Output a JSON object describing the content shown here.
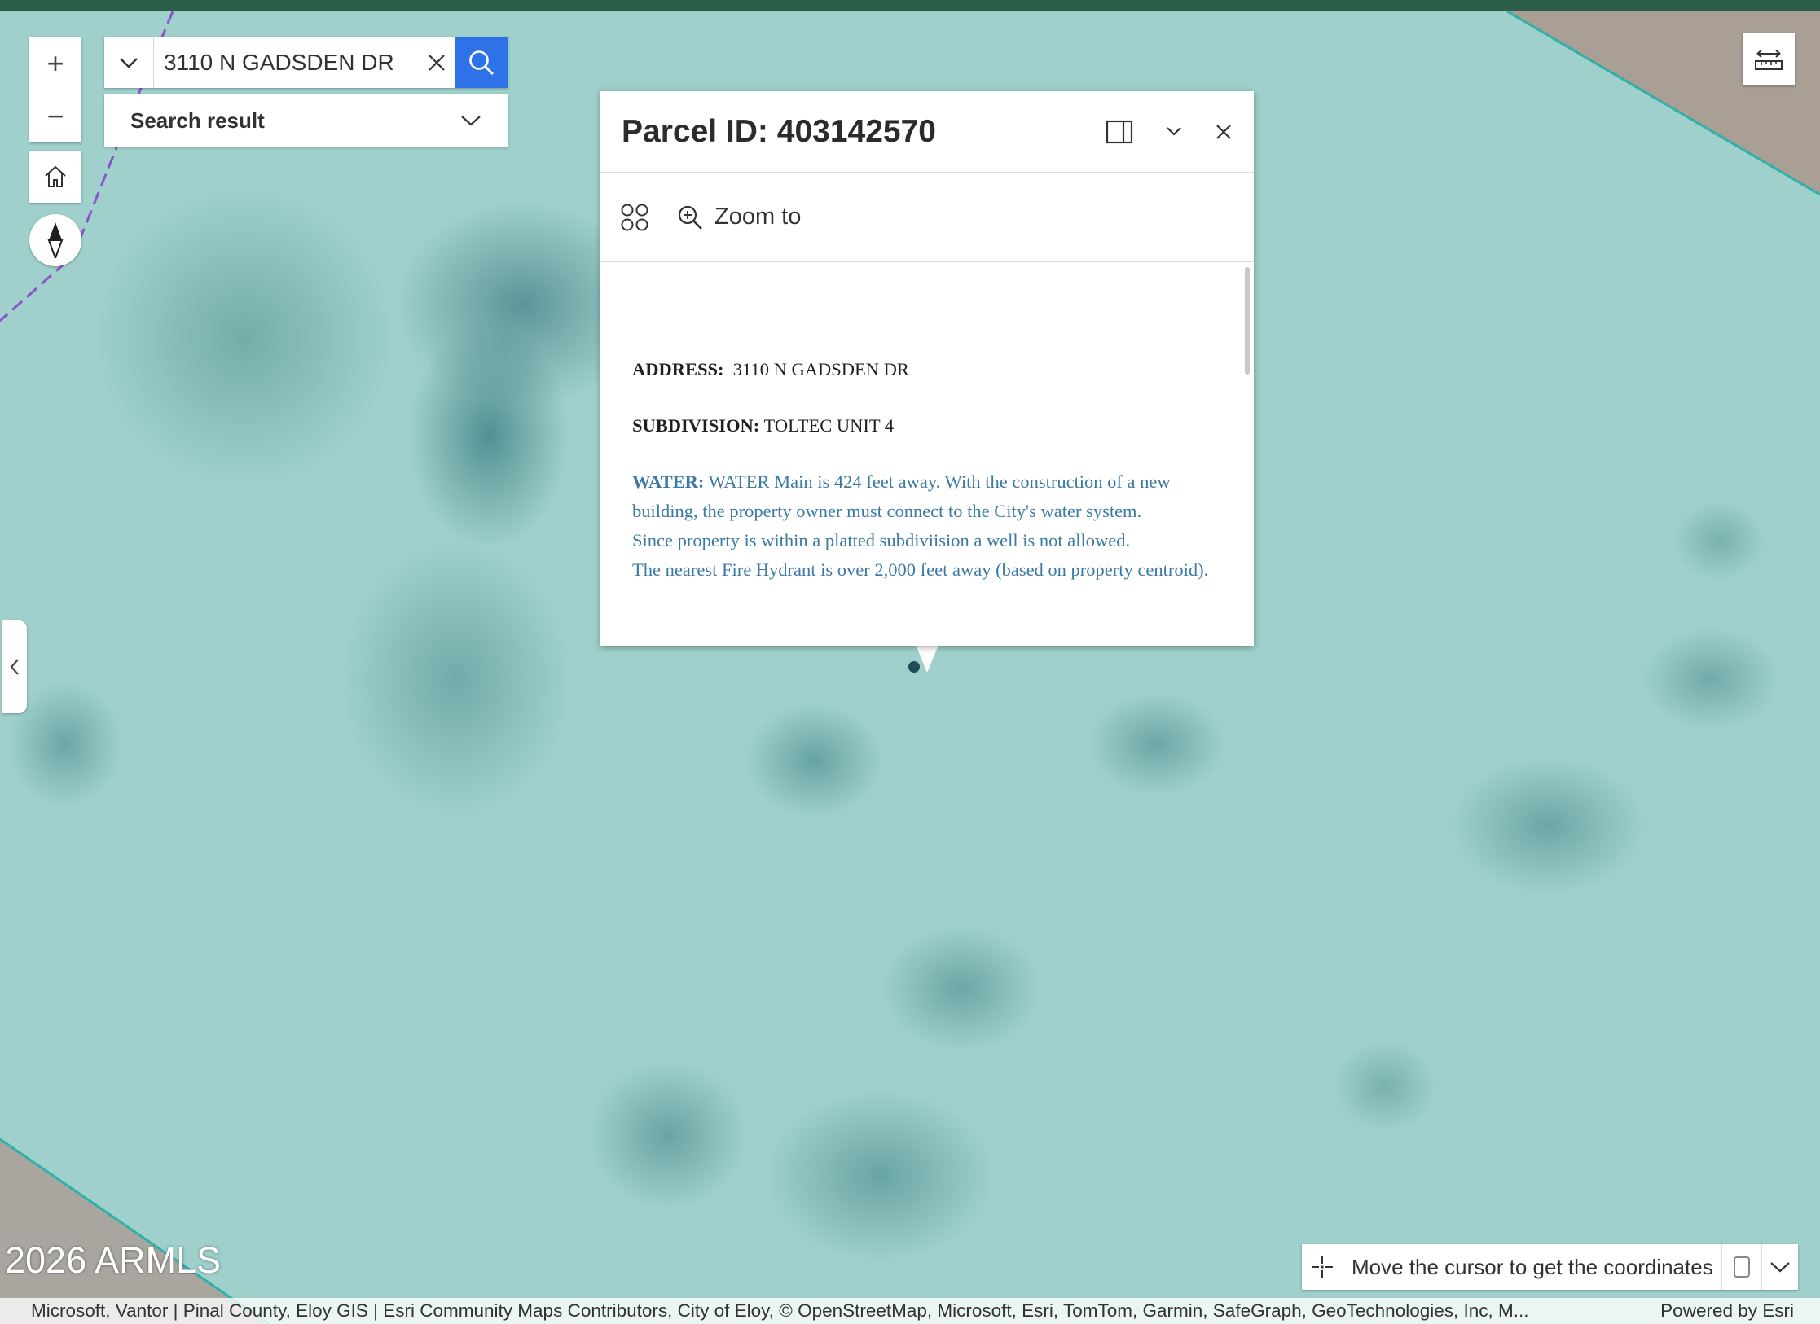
{
  "map": {
    "watermark": "2026 ARMLS",
    "attribution": "Microsoft, Vantor | Pinal County, Eloy GIS | Esri Community Maps Contributors, City of Eloy, © OpenStreetMap, Microsoft, Esri, TomTom, Garmin, SafeGraph, GeoTechnologies, Inc, M...",
    "powered_by": "Powered by Esri"
  },
  "controls": {
    "zoom_in_label": "+",
    "zoom_out_label": "−",
    "home_icon": "home-icon",
    "compass_icon": "compass-icon"
  },
  "search": {
    "value": "3110 N GADSDEN DR",
    "result_label": "Search result"
  },
  "popup": {
    "title": "Parcel ID: 403142570",
    "zoom_to_label": "Zoom to",
    "fields": {
      "address_label": "ADDRESS:",
      "address_value": "3110 N GADSDEN DR",
      "subdivision_label": "SUBDIVISION:",
      "subdivision_value": "TOLTEC UNIT 4",
      "water_label": "WATER:",
      "water_text": "WATER Main is 424 feet away. With the construction of a new building, the property owner must connect to the City's water system.",
      "water_well": "Since property is within a platted subdiviision a well is not allowed.",
      "water_hydrant": "The nearest Fire Hydrant is over 2,000 feet away (based on property centroid)."
    }
  },
  "coordinates": {
    "prompt": "Move the cursor to get the coordinates"
  },
  "colors": {
    "header_bar": "#2c5d46",
    "search_button": "#2e72e8",
    "water_text": "#3a78a6",
    "parcel_fill": "#9fd0cb"
  }
}
